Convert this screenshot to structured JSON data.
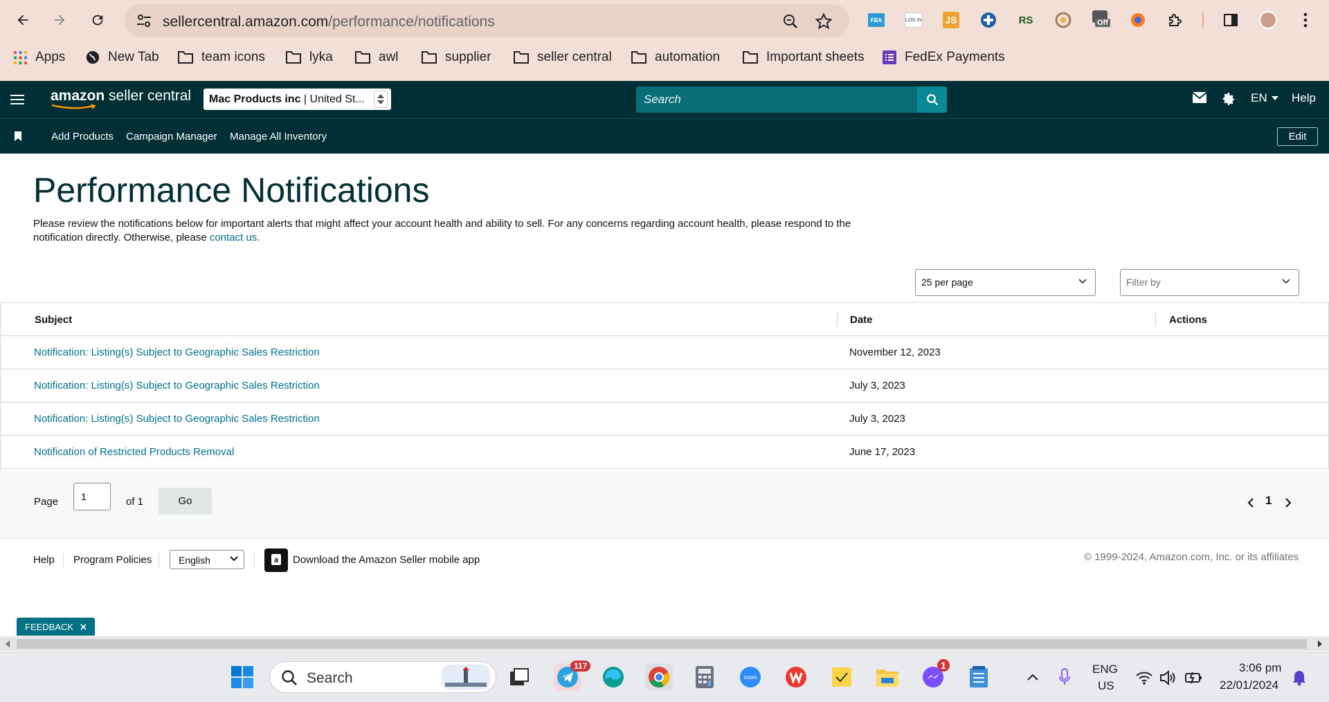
{
  "browser": {
    "url_domain": "sellercentral.amazon.com",
    "url_path": "/performance/notifications",
    "bookmarks": [
      "Apps",
      "New Tab",
      "team icons",
      "lyka",
      "awl",
      "supplier",
      "seller central",
      "automation",
      "Important sheets",
      "FedEx Payments"
    ],
    "ext_fba": "FBA",
    "ext_login": "LOG IN",
    "ext_js": "JS",
    "ext_rs": "RS",
    "ext_off": "Off"
  },
  "header": {
    "logo_word": "amazon",
    "logo_rest": " seller central",
    "account_name": "Mac Products inc",
    "account_region": " | United St...",
    "search_placeholder": "Search",
    "lang": "EN",
    "help": "Help"
  },
  "subnav": {
    "links": [
      "Add Products",
      "Campaign Manager",
      "Manage All Inventory"
    ],
    "edit": "Edit"
  },
  "main": {
    "title": "Performance Notifications",
    "intro": "Please review the notifications below for important alerts that might affect your account health and ability to sell. For any concerns regarding account health, please respond to the notification directly. Otherwise, please ",
    "intro_link": "contact us.",
    "per_page": "25 per page",
    "filter_by": "Filter by",
    "columns": [
      "Subject",
      "Date",
      "Actions"
    ],
    "rows": [
      {
        "subject": "Notification: Listing(s) Subject to Geographic Sales Restriction",
        "date": "November 12, 2023"
      },
      {
        "subject": "Notification: Listing(s) Subject to Geographic Sales Restriction",
        "date": "July 3, 2023"
      },
      {
        "subject": "Notification: Listing(s) Subject to Geographic Sales Restriction",
        "date": "July 3, 2023"
      },
      {
        "subject": "Notification of Restricted Products Removal",
        "date": "June 17, 2023"
      }
    ]
  },
  "pager": {
    "page_label": "Page",
    "page_value": "1",
    "of_label": "of 1",
    "go": "Go",
    "current": "1"
  },
  "footer": {
    "help": "Help",
    "policies": "Program Policies",
    "language": "English",
    "download": "Download the Amazon Seller mobile app",
    "copyright": "© 1999-2024, Amazon.com, Inc. or its affiliates",
    "feedback": "FEEDBACK"
  },
  "taskbar": {
    "search": "Search",
    "telegram_badge": "117",
    "messenger_badge": "1",
    "lang_top": "ENG",
    "lang_bottom": "US",
    "time": "3:06 pm",
    "date": "22/01/2024"
  },
  "colors": {
    "header_bg": "#002f36",
    "chrome_bg": "#f2dfd8",
    "link": "#00718c",
    "search_bg": "#0a6d77"
  }
}
